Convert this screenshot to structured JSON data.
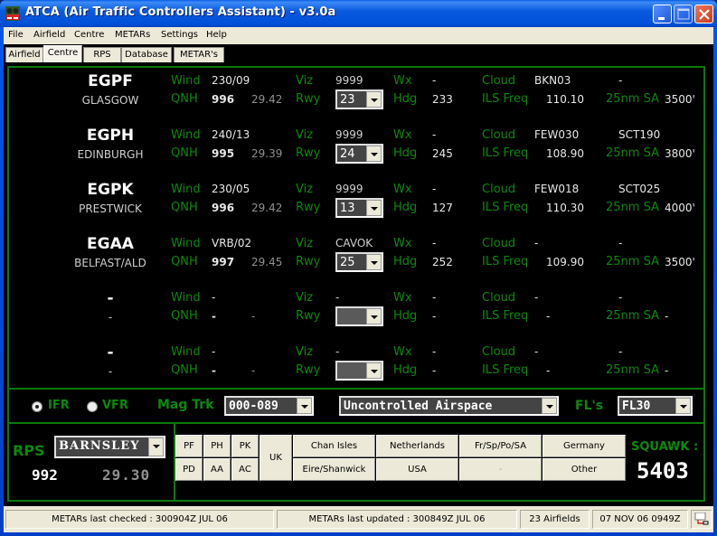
{
  "window": {
    "title": "ATCA (Air Traffic Controllers Assistant) - v3.0a",
    "controls": {
      "minimize": "minimize",
      "maximize": "maximize",
      "close": "close"
    }
  },
  "menu": [
    "File",
    "Airfield",
    "Centre",
    "METARs",
    "Settings",
    "Help"
  ],
  "tabs": [
    {
      "label": "Airfield",
      "active": false
    },
    {
      "label": "Centre",
      "active": true
    },
    {
      "label": "RPS",
      "active": false
    },
    {
      "label": "Database",
      "active": false
    },
    {
      "label": "METAR's",
      "active": false
    }
  ],
  "labels": {
    "wind": "Wind",
    "qnh": "QNH",
    "viz": "Viz",
    "rwy": "Rwy",
    "wx": "Wx",
    "hdg": "Hdg",
    "cloud": "Cloud",
    "ils": "ILS Freq",
    "sa": "25nm SA"
  },
  "airfields": [
    {
      "icao": "EGPF",
      "name": "GLASGOW",
      "wind": "230/09",
      "qnh": "996",
      "inhg": "29.42",
      "viz": "9999",
      "rwy": "23",
      "wx": "-",
      "hdg": "233",
      "cloud1": "BKN03",
      "cloud2": "-",
      "ils": "110.10",
      "sa": "3500'"
    },
    {
      "icao": "EGPH",
      "name": "EDINBURGH",
      "wind": "240/13",
      "qnh": "995",
      "inhg": "29.39",
      "viz": "9999",
      "rwy": "24",
      "wx": "-",
      "hdg": "245",
      "cloud1": "FEW030",
      "cloud2": "SCT190",
      "ils": "108.90",
      "sa": "3800'"
    },
    {
      "icao": "EGPK",
      "name": "PRESTWICK",
      "wind": "230/05",
      "qnh": "996",
      "inhg": "29.42",
      "viz": "9999",
      "rwy": "13",
      "wx": "-",
      "hdg": "127",
      "cloud1": "FEW018",
      "cloud2": "SCT025",
      "ils": "110.30",
      "sa": "4000'"
    },
    {
      "icao": "EGAA",
      "name": "BELFAST/ALD",
      "wind": "VRB/02",
      "qnh": "997",
      "inhg": "29.45",
      "viz": "CAVOK",
      "rwy": "25",
      "wx": "-",
      "hdg": "252",
      "cloud1": "-",
      "cloud2": "-",
      "ils": "109.90",
      "sa": "3500'"
    },
    {
      "icao": "-",
      "name": "-",
      "wind": "-",
      "qnh": "-",
      "inhg": "-",
      "viz": "-",
      "rwy": "",
      "wx": "-",
      "hdg": "-",
      "cloud1": "-",
      "cloud2": "-",
      "ils": "-",
      "sa": "-"
    },
    {
      "icao": "-",
      "name": "-",
      "wind": "-",
      "qnh": "-",
      "inhg": "-",
      "viz": "-",
      "rwy": "",
      "wx": "-",
      "hdg": "-",
      "cloud1": "-",
      "cloud2": "-",
      "ils": "-",
      "sa": "-"
    }
  ],
  "flight": {
    "ifr_label": "IFR",
    "vfr_label": "VFR",
    "rule_selected": "IFR",
    "magtrk_label": "Mag Trk",
    "magtrk_value": "000-089",
    "airspace_value": "Uncontrolled Airspace",
    "fls_label": "FL's",
    "fl_value": "FL30"
  },
  "rps": {
    "label": "RPS",
    "region": "BARNSLEY",
    "qnh": "992",
    "inhg": "29.30"
  },
  "squawk_buttons": {
    "row1": [
      "PF",
      "PH",
      "PK"
    ],
    "row2": [
      "PD",
      "AA",
      "AC"
    ],
    "uk": "UK",
    "regions_row1": [
      "Chan Isles",
      "Netherlands",
      "Fr/Sp/Po/SA",
      "Germany"
    ],
    "regions_row2": [
      "Eire/Shanwick",
      "USA",
      "-",
      "Other"
    ]
  },
  "squawk": {
    "label": "SQUAWK :",
    "code": "5403"
  },
  "status": {
    "checked": "METARs last checked : 300904Z JUL 06",
    "updated": "METARs last updated : 300849Z JUL 06",
    "airfields": "23 Airfields",
    "datetime": "07 NOV 06 0949Z"
  },
  "colors": {
    "label_green": "#0a8a0a",
    "frame_green": "#0a7a0a",
    "bg": "#000000"
  }
}
